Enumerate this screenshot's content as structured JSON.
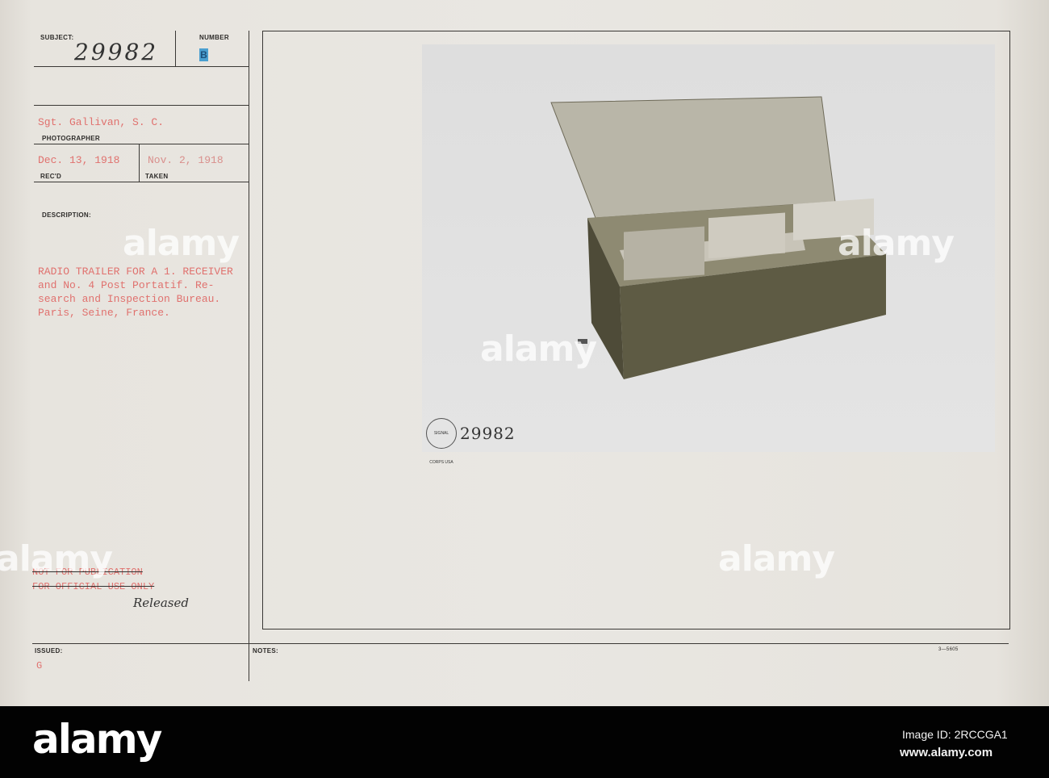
{
  "card": {
    "subject_label": "SUBJECT:",
    "subject_value": "29982",
    "number_label": "NUMBER",
    "number_stamp": "B",
    "photographer_value": "Sgt. Gallivan, S. C.",
    "photographer_label": "PHOTOGRAPHER",
    "received_value": "Dec. 13, 1918",
    "received_label": "REC'D",
    "taken_value": "Nov. 2, 1918",
    "taken_label": "TAKEN",
    "description_label": "DESCRIPTION:",
    "description_lines": [
      "RADIO TRAILER FOR A 1. RECEIVER",
      "and No. 4 Post Portatif. Re-",
      "search and Inspection Bureau.",
      "Paris, Seine, France."
    ],
    "restriction_lines": [
      "NOT FOR PUBLICATION",
      "FOR OFFICIAL USE ONLY"
    ],
    "released_note": "Released",
    "issued_label": "ISSUED:",
    "issued_value": "G",
    "notes_label": "NOTES:",
    "form_number": "3—5605"
  },
  "photo": {
    "seal_text": "SIGNAL CORPS USA",
    "negative_number": "29982"
  },
  "watermark": "alamy",
  "footer": {
    "logo": "alamy",
    "image_id": "Image ID: 2RCCGA1",
    "site": "www.alamy.com"
  },
  "colors": {
    "typewriter_red": "#e0716e",
    "stamp_blue": "#4a9fd0",
    "footer_bg": "#020202"
  }
}
